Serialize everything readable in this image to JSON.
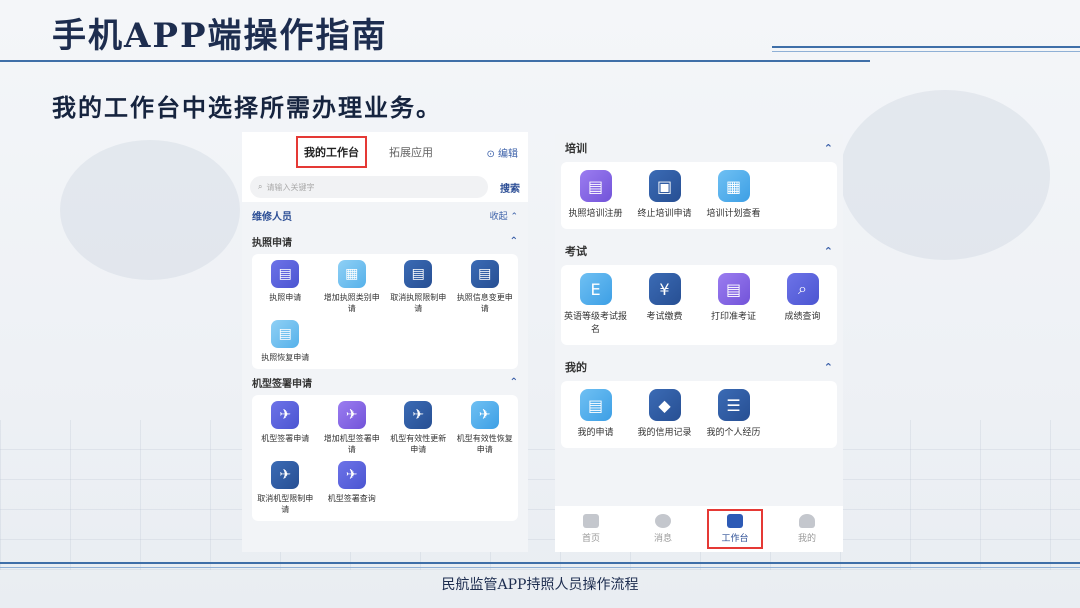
{
  "slide": {
    "title": "手机APP端操作指南",
    "subtitle": "我的工作台中选择所需办理业务。",
    "footer": "民航监管APP持照人员操作流程"
  },
  "left_panel": {
    "tabs": [
      "我的工作台",
      "拓展应用"
    ],
    "edit_label": "编辑",
    "search": {
      "placeholder": "请输入关键字",
      "button": "搜索"
    },
    "role": {
      "label": "维修人员",
      "collapse": "收起"
    },
    "sections": [
      {
        "title": "执照申请",
        "items": [
          {
            "label": "执照申请",
            "icon": "license-apply-icon",
            "color": "#4b55d1"
          },
          {
            "label": "增加执照类别申请",
            "icon": "add-license-category-icon",
            "color": "#56b1ea"
          },
          {
            "label": "取消执照限制申请",
            "icon": "cancel-license-restriction-icon",
            "color": "#274f93"
          },
          {
            "label": "执照信息变更申请",
            "icon": "license-info-change-icon",
            "color": "#274f93"
          },
          {
            "label": "执照恢复申请",
            "icon": "license-restore-icon",
            "color": "#56b1ea"
          }
        ]
      },
      {
        "title": "机型签署申请",
        "items": [
          {
            "label": "机型签署申请",
            "icon": "airplane-icon",
            "color": "#4b55d1"
          },
          {
            "label": "增加机型签署申请",
            "icon": "airplane-add-icon",
            "color": "#7253d9"
          },
          {
            "label": "机型有效性更新申请",
            "icon": "airplane-update-icon",
            "color": "#274f93"
          },
          {
            "label": "机型有效性恢复申请",
            "icon": "airplane-restore-icon",
            "color": "#3d9fe5"
          },
          {
            "label": "取消机型限制申请",
            "icon": "airplane-cancel-icon",
            "color": "#274f93"
          },
          {
            "label": "机型签署查询",
            "icon": "airplane-query-icon",
            "color": "#4b55d1"
          }
        ]
      }
    ]
  },
  "right_panel": {
    "sections": [
      {
        "title": "培训",
        "items": [
          {
            "label": "执照培训注册",
            "icon": "training-register-icon"
          },
          {
            "label": "终止培训申请",
            "icon": "training-terminate-icon"
          },
          {
            "label": "培训计划查看",
            "icon": "training-plan-icon"
          }
        ]
      },
      {
        "title": "考试",
        "items": [
          {
            "label": "英语等级考试报名",
            "icon": "english-exam-icon"
          },
          {
            "label": "考试缴费",
            "icon": "exam-payment-icon"
          },
          {
            "label": "打印准考证",
            "icon": "admission-ticket-icon"
          },
          {
            "label": "成绩查询",
            "icon": "score-query-icon"
          }
        ]
      },
      {
        "title": "我的",
        "items": [
          {
            "label": "我的申请",
            "icon": "my-application-icon"
          },
          {
            "label": "我的信用记录",
            "icon": "credit-record-icon"
          },
          {
            "label": "我的个人经历",
            "icon": "personal-history-icon"
          }
        ]
      }
    ],
    "tabbar": [
      {
        "label": "首页",
        "icon": "home-icon"
      },
      {
        "label": "消息",
        "icon": "message-icon"
      },
      {
        "label": "工作台",
        "icon": "workbench-icon",
        "active": true
      },
      {
        "label": "我的",
        "icon": "profile-icon"
      }
    ]
  }
}
